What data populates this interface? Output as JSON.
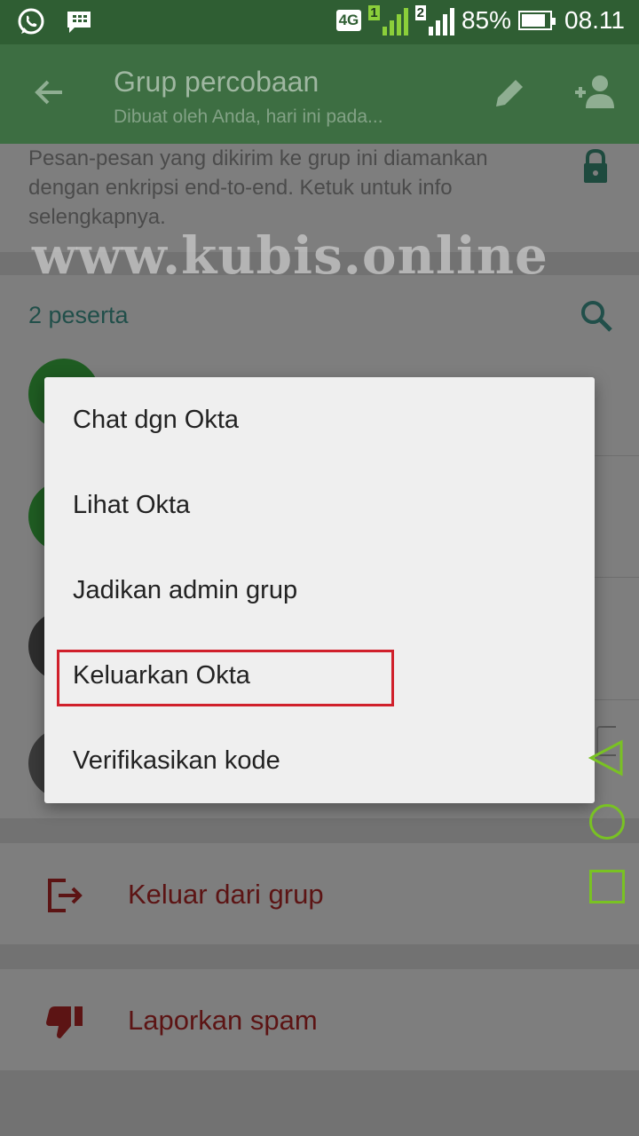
{
  "status_bar": {
    "network": "4G",
    "sim1": "1",
    "sim2": "2",
    "battery_percent": "85%",
    "battery_level": 0.85,
    "time": "08.11",
    "icons": [
      "whatsapp-icon",
      "bbm-icon"
    ]
  },
  "app_bar": {
    "title": "Grup percobaan",
    "subtitle": "Dibuat oleh Anda, hari ini pada..."
  },
  "encryption": {
    "text": "Pesan-pesan yang dikirim ke grup ini diamankan dengan enkripsi end-to-end. Ketuk untuk info selengkapnya."
  },
  "watermark": "www.kubis.online",
  "participants": {
    "count_label": "2 peserta"
  },
  "menu": {
    "items": [
      {
        "label": "Chat dgn Okta"
      },
      {
        "label": "Lihat Okta"
      },
      {
        "label": "Jadikan admin grup"
      },
      {
        "label": "Keluarkan Okta"
      },
      {
        "label": "Verifikasikan kode"
      }
    ],
    "highlighted_index": 3
  },
  "actions": {
    "exit_label": "Keluar dari grup",
    "spam_label": "Laporkan spam"
  },
  "colors": {
    "accent": "#2f5e33",
    "danger": "#5c1414",
    "highlight": "#d0202b",
    "nav_overlay": "#79c223"
  }
}
